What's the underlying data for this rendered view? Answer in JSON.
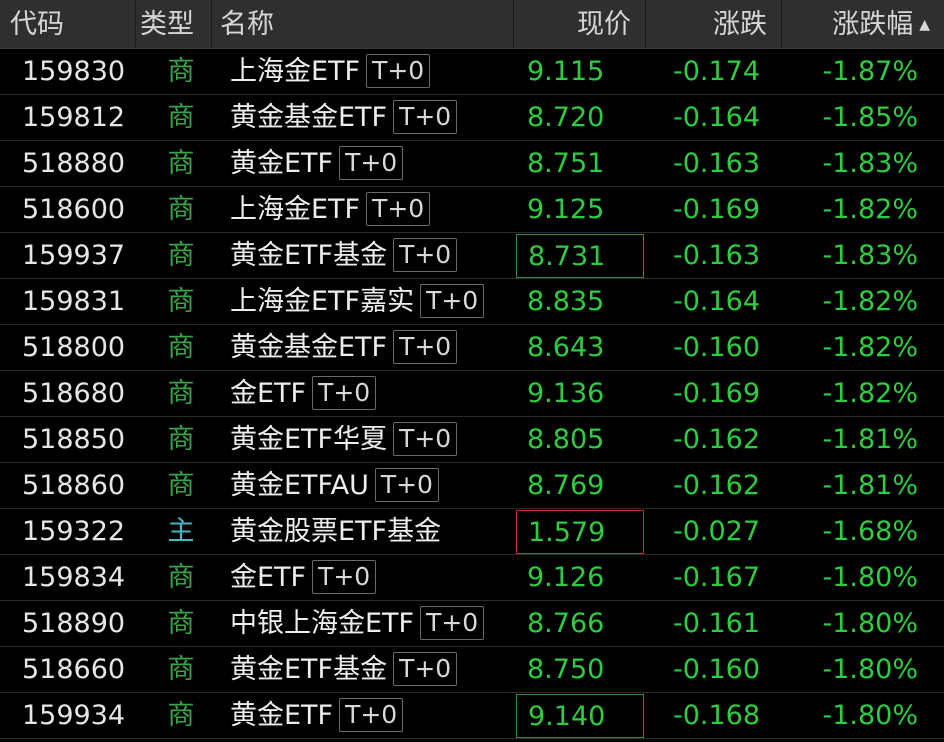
{
  "header": {
    "code": "代码",
    "type": "类型",
    "name": "名称",
    "price": "现价",
    "change": "涨跌",
    "pct": "涨跌幅",
    "sort_icon": "triangle-up-icon"
  },
  "colors": {
    "background": "#000000",
    "header_bg": "#2f2f31",
    "down_green": "#2ecc40",
    "type_green": "#3aa34a",
    "type_cyan": "#46b6c4",
    "box_green": "#2f8a3a",
    "box_red": "#c03030"
  },
  "rows": [
    {
      "code": "159830",
      "type": "商",
      "name": "上海金ETF",
      "tag": "T+0",
      "price": "9.115",
      "change": "-0.174",
      "pct": "-1.87%",
      "box": ""
    },
    {
      "code": "159812",
      "type": "商",
      "name": "黄金基金ETF",
      "tag": "T+0",
      "price": "8.720",
      "change": "-0.164",
      "pct": "-1.85%",
      "box": ""
    },
    {
      "code": "518880",
      "type": "商",
      "name": "黄金ETF",
      "tag": "T+0",
      "price": "8.751",
      "change": "-0.163",
      "pct": "-1.83%",
      "box": ""
    },
    {
      "code": "518600",
      "type": "商",
      "name": "上海金ETF",
      "tag": "T+0",
      "price": "9.125",
      "change": "-0.169",
      "pct": "-1.82%",
      "box": ""
    },
    {
      "code": "159937",
      "type": "商",
      "name": "黄金ETF基金",
      "tag": "T+0",
      "price": "8.731",
      "change": "-0.163",
      "pct": "-1.83%",
      "box": "green"
    },
    {
      "code": "159831",
      "type": "商",
      "name": "上海金ETF嘉实",
      "tag": "T+0",
      "price": "8.835",
      "change": "-0.164",
      "pct": "-1.82%",
      "box": ""
    },
    {
      "code": "518800",
      "type": "商",
      "name": "黄金基金ETF",
      "tag": "T+0",
      "price": "8.643",
      "change": "-0.160",
      "pct": "-1.82%",
      "box": ""
    },
    {
      "code": "518680",
      "type": "商",
      "name": "金ETF",
      "tag": "T+0",
      "price": "9.136",
      "change": "-0.169",
      "pct": "-1.82%",
      "box": ""
    },
    {
      "code": "518850",
      "type": "商",
      "name": "黄金ETF华夏",
      "tag": "T+0",
      "price": "8.805",
      "change": "-0.162",
      "pct": "-1.81%",
      "box": ""
    },
    {
      "code": "518860",
      "type": "商",
      "name": "黄金ETFAU",
      "tag": "T+0",
      "price": "8.769",
      "change": "-0.162",
      "pct": "-1.81%",
      "box": ""
    },
    {
      "code": "159322",
      "type": "主",
      "name": "黄金股票ETF基金",
      "tag": "",
      "price": "1.579",
      "change": "-0.027",
      "pct": "-1.68%",
      "box": "red"
    },
    {
      "code": "159834",
      "type": "商",
      "name": "金ETF",
      "tag": "T+0",
      "price": "9.126",
      "change": "-0.167",
      "pct": "-1.80%",
      "box": ""
    },
    {
      "code": "518890",
      "type": "商",
      "name": "中银上海金ETF",
      "tag": "T+0",
      "price": "8.766",
      "change": "-0.161",
      "pct": "-1.80%",
      "box": ""
    },
    {
      "code": "518660",
      "type": "商",
      "name": "黄金ETF基金",
      "tag": "T+0",
      "price": "8.750",
      "change": "-0.160",
      "pct": "-1.80%",
      "box": ""
    },
    {
      "code": "159934",
      "type": "商",
      "name": "黄金ETF",
      "tag": "T+0",
      "price": "9.140",
      "change": "-0.168",
      "pct": "-1.80%",
      "box": "green"
    }
  ]
}
